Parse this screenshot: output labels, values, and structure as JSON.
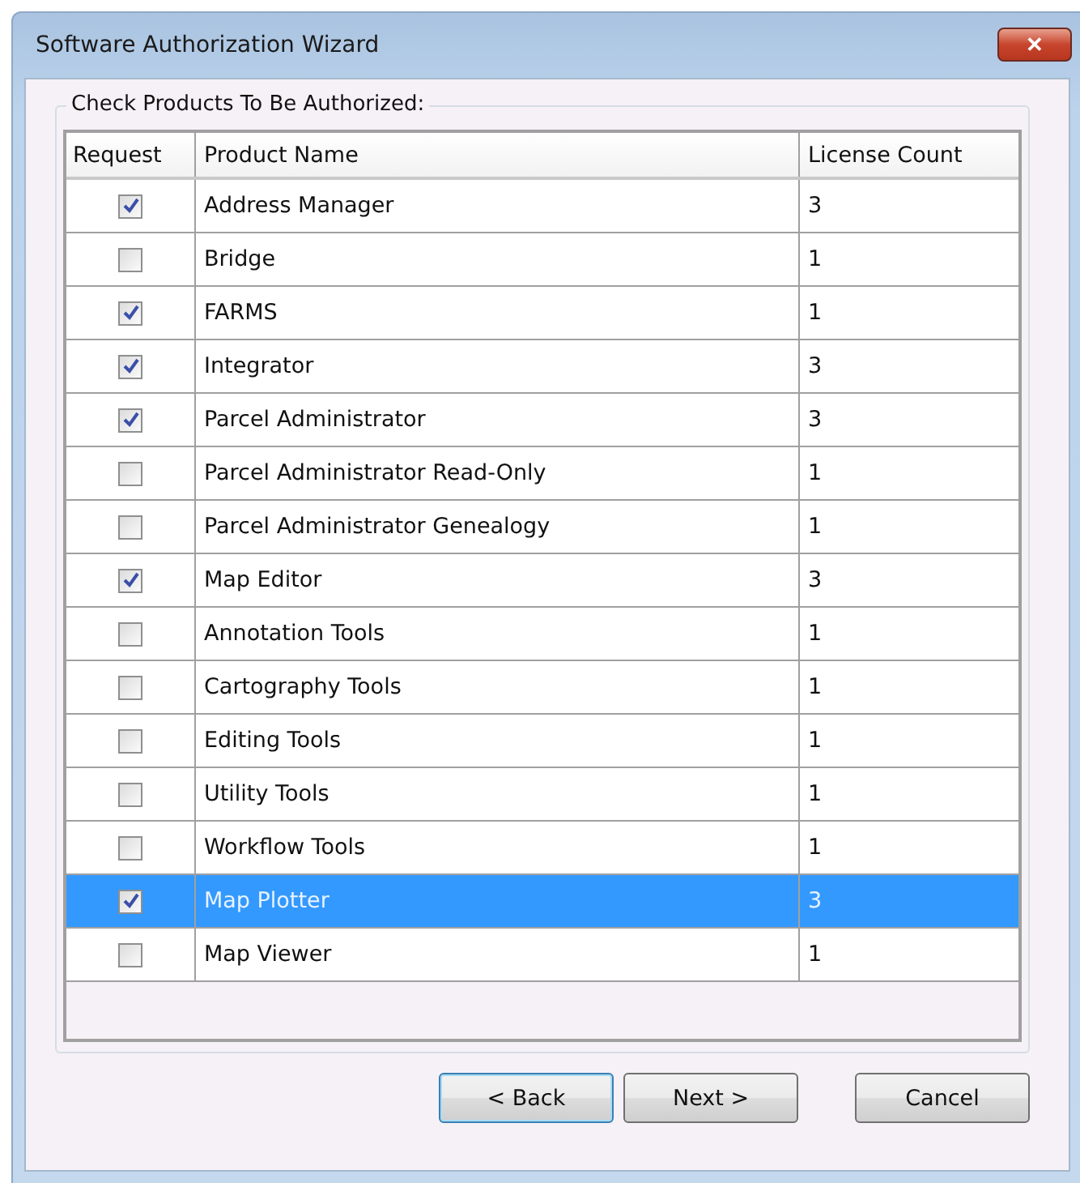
{
  "window": {
    "title": "Software Authorization Wizard",
    "close_label": "✕"
  },
  "group": {
    "label": "Check Products To Be Authorized:"
  },
  "table": {
    "columns": [
      "Request",
      "Product Name",
      "License Count"
    ],
    "rows": [
      {
        "checked": true,
        "selected": false,
        "name": "Address Manager",
        "count": "3"
      },
      {
        "checked": false,
        "selected": false,
        "name": "Bridge",
        "count": "1"
      },
      {
        "checked": true,
        "selected": false,
        "name": "FARMS",
        "count": "1"
      },
      {
        "checked": true,
        "selected": false,
        "name": "Integrator",
        "count": "3"
      },
      {
        "checked": true,
        "selected": false,
        "name": "Parcel Administrator",
        "count": "3"
      },
      {
        "checked": false,
        "selected": false,
        "name": "Parcel Administrator Read-Only",
        "count": "1"
      },
      {
        "checked": false,
        "selected": false,
        "name": "Parcel Administrator Genealogy",
        "count": "1"
      },
      {
        "checked": true,
        "selected": false,
        "name": "Map Editor",
        "count": "3"
      },
      {
        "checked": false,
        "selected": false,
        "name": "Annotation Tools",
        "count": "1"
      },
      {
        "checked": false,
        "selected": false,
        "name": "Cartography Tools",
        "count": "1"
      },
      {
        "checked": false,
        "selected": false,
        "name": "Editing Tools",
        "count": "1"
      },
      {
        "checked": false,
        "selected": false,
        "name": "Utility Tools",
        "count": "1"
      },
      {
        "checked": false,
        "selected": false,
        "name": "Workflow Tools",
        "count": "1"
      },
      {
        "checked": true,
        "selected": true,
        "name": "Map Plotter",
        "count": "3"
      },
      {
        "checked": false,
        "selected": false,
        "name": "Map Viewer",
        "count": "1"
      }
    ]
  },
  "buttons": [
    {
      "label": "< Back",
      "kind": "focused"
    },
    {
      "label": "Next >",
      "kind": "normal"
    },
    {
      "label": "Cancel",
      "kind": "cancel"
    }
  ]
}
